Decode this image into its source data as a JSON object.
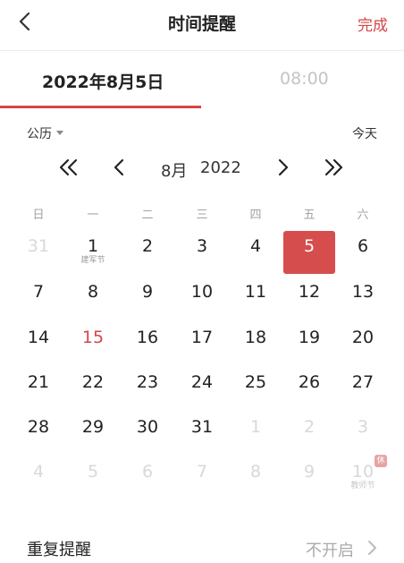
{
  "header": {
    "title": "时间提醒",
    "done_label": "完成"
  },
  "tabs": {
    "date": "2022年8月5日",
    "time": "08:00"
  },
  "toolbar": {
    "calendar_mode": "公历",
    "today_label": "今天"
  },
  "nav": {
    "month": "8月",
    "year": "2022"
  },
  "weekdays": [
    "日",
    "一",
    "二",
    "三",
    "四",
    "五",
    "六"
  ],
  "weeks": [
    [
      {
        "d": "31",
        "muted": true
      },
      {
        "d": "1",
        "sub": "建军节"
      },
      {
        "d": "2"
      },
      {
        "d": "3"
      },
      {
        "d": "4"
      },
      {
        "d": "5",
        "selected": true
      },
      {
        "d": "6"
      }
    ],
    [
      {
        "d": "7"
      },
      {
        "d": "8"
      },
      {
        "d": "9"
      },
      {
        "d": "10"
      },
      {
        "d": "11"
      },
      {
        "d": "12"
      },
      {
        "d": "13"
      }
    ],
    [
      {
        "d": "14"
      },
      {
        "d": "15",
        "red": true
      },
      {
        "d": "16"
      },
      {
        "d": "17"
      },
      {
        "d": "18"
      },
      {
        "d": "19"
      },
      {
        "d": "20"
      }
    ],
    [
      {
        "d": "21"
      },
      {
        "d": "22"
      },
      {
        "d": "23"
      },
      {
        "d": "24"
      },
      {
        "d": "25"
      },
      {
        "d": "26"
      },
      {
        "d": "27"
      }
    ],
    [
      {
        "d": "28"
      },
      {
        "d": "29"
      },
      {
        "d": "30"
      },
      {
        "d": "31"
      },
      {
        "d": "1",
        "muted": true
      },
      {
        "d": "2",
        "muted": true
      },
      {
        "d": "3",
        "muted": true
      }
    ],
    [
      {
        "d": "4",
        "muted": true
      },
      {
        "d": "5",
        "muted": true
      },
      {
        "d": "6",
        "muted": true
      },
      {
        "d": "7",
        "muted": true
      },
      {
        "d": "8",
        "muted": true
      },
      {
        "d": "9",
        "muted": true
      },
      {
        "d": "10",
        "muted": true,
        "sub": "教师节",
        "badge": "休"
      }
    ]
  ],
  "repeat": {
    "label": "重复提醒",
    "value": "不开启"
  },
  "colors": {
    "accent": "#d64545",
    "selected_bg": "#d64d4d",
    "muted_text": "#d8d8d8"
  },
  "icons": {
    "back": "chevron-left-icon",
    "prev_year": "double-chevron-left-icon",
    "prev_month": "chevron-left-icon",
    "next_month": "chevron-right-icon",
    "next_year": "double-chevron-right-icon",
    "repeat_arrow": "chevron-right-icon",
    "dropdown": "caret-down-icon"
  }
}
